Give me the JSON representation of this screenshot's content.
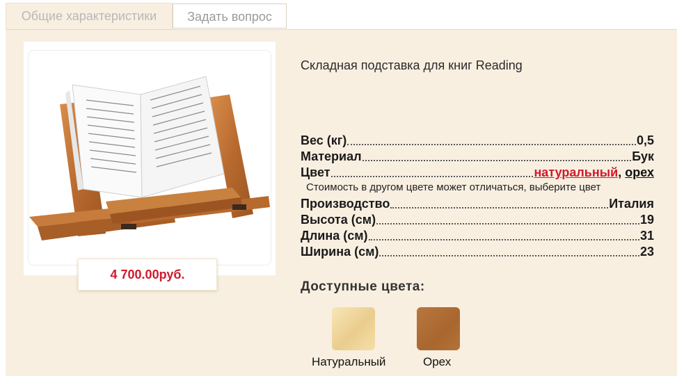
{
  "tabs": [
    {
      "label": "Общие характеристики"
    },
    {
      "label": "Задать вопрос"
    }
  ],
  "product": {
    "title": "Складная подставка для книг Reading",
    "price": "4 700.00руб.",
    "image_alt": "Книга на складной деревянной подставке"
  },
  "specs": {
    "weight": {
      "key": "Вес (кг)",
      "value": "0,5"
    },
    "material": {
      "key": "Материал",
      "value": "Бук"
    },
    "color": {
      "key": "Цвет",
      "option1": "натуральный",
      "separator": ",",
      "option2": "орех"
    },
    "color_note": "Стоимость в другом цвете может отличаться, выберите цвет",
    "origin": {
      "key": "Производство",
      "value": "Италия"
    },
    "height": {
      "key": "Высота (см)",
      "value": "19"
    },
    "length": {
      "key": "Длина (см)",
      "value": "31"
    },
    "width": {
      "key": "Ширина (см)",
      "value": "23"
    }
  },
  "available_colors": {
    "title": "Доступные цвета:",
    "items": [
      {
        "label": "Натуральный",
        "color": "#f0d79e"
      },
      {
        "label": "Орех",
        "color": "#ad6b33"
      }
    ]
  },
  "colors": {
    "panel_bg": "#f8efe1",
    "price": "#d0192c",
    "link": "#d0192c"
  }
}
